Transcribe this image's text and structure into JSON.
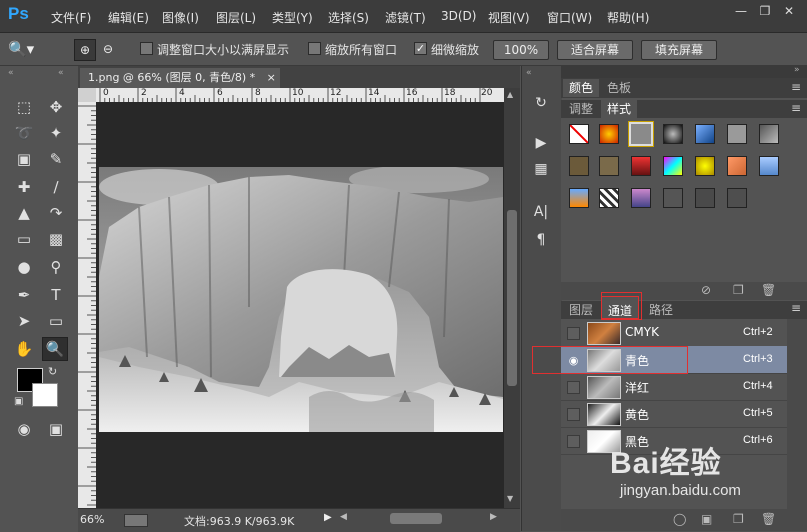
{
  "app": {
    "logo": "Ps"
  },
  "menubar": {
    "items": [
      "文件(F)",
      "编辑(E)",
      "图像(I)",
      "图层(L)",
      "类型(Y)",
      "选择(S)",
      "滤镜(T)",
      "3D(D)",
      "视图(V)",
      "窗口(W)",
      "帮助(H)"
    ],
    "window_controls": [
      "minimize-icon",
      "restore-icon",
      "close-icon"
    ]
  },
  "options": {
    "tool_icon": "zoom-tool-icon",
    "resize_windows_label": "调整窗口大小以满屏显示",
    "resize_windows_checked": false,
    "zoom_all_label": "缩放所有窗口",
    "zoom_all_checked": false,
    "scrubby_label": "细微缩放",
    "scrubby_checked": true,
    "btn_100": "100%",
    "btn_fit": "适合屏幕",
    "btn_fill": "填充屏幕"
  },
  "document": {
    "tab_title": "1.png @ 66% (图层 0, 青色/8) *",
    "zoom": "66%",
    "doc_info": "文档:963.9 K/963.9K",
    "ruler_ticks": [
      "0",
      "2",
      "4",
      "6",
      "8",
      "10",
      "12",
      "14",
      "16",
      "18",
      "20"
    ]
  },
  "panels": {
    "color_tabs": [
      "颜色",
      "色板"
    ],
    "adj_tabs": [
      "调整",
      "样式"
    ],
    "active_adj_tab": "样式",
    "layer_tabs": [
      "图层",
      "通道",
      "路径"
    ],
    "active_layer_tab": "通道"
  },
  "channels": [
    {
      "name": "CMYK",
      "shortcut": "Ctrl+2",
      "visible": false,
      "selected": false
    },
    {
      "name": "青色",
      "shortcut": "Ctrl+3",
      "visible": true,
      "selected": true
    },
    {
      "name": "洋红",
      "shortcut": "Ctrl+4",
      "visible": false,
      "selected": false
    },
    {
      "name": "黄色",
      "shortcut": "Ctrl+5",
      "visible": false,
      "selected": false
    },
    {
      "name": "黑色",
      "shortcut": "Ctrl+6",
      "visible": false,
      "selected": false
    }
  ],
  "watermark": {
    "brand": "Bai经验",
    "url": "jingyan.baidu.com"
  },
  "colors": {
    "highlight": "#e03030",
    "selected_row": "#7d8aa3",
    "logo_blue": "#31a8ff"
  }
}
